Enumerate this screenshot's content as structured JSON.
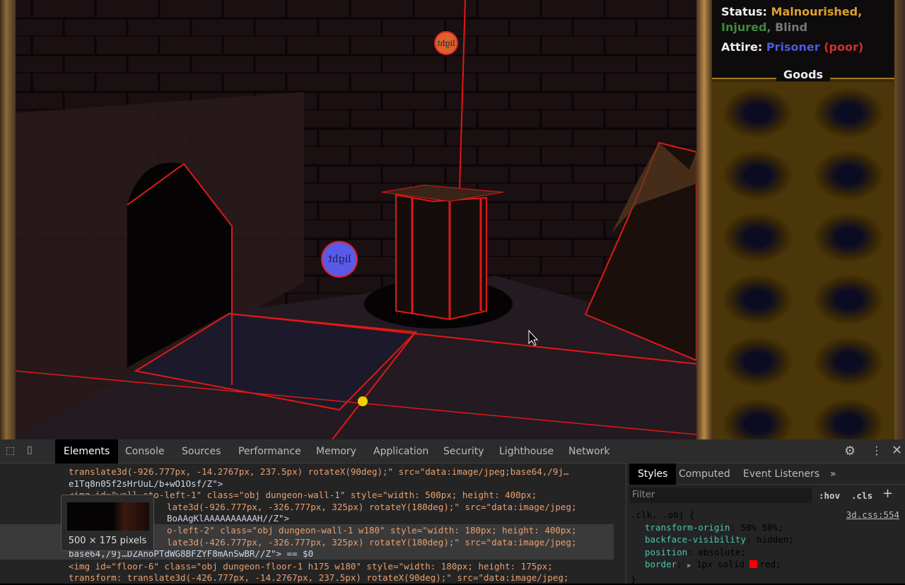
{
  "game": {
    "orbs": [
      {
        "label": "light",
        "color": "#d8642a"
      },
      {
        "label": "light",
        "color": "#5a5ae8"
      }
    ],
    "status_label": "Status:",
    "status_values": [
      "Malnourished,",
      "Injured,",
      "Blind"
    ],
    "status_colors": [
      "#e0a030",
      "#3a8a3a",
      "#777777"
    ],
    "attire_label": "Attire:",
    "attire_value": "Prisoner",
    "attire_quality": "(poor)",
    "goods_title": "Goods",
    "goods_slots": 12
  },
  "devtools": {
    "tabs": [
      "Elements",
      "Console",
      "Sources",
      "Performance",
      "Memory",
      "Application",
      "Security",
      "Lighthouse",
      "Network"
    ],
    "active_tab": "Elements",
    "code_lines": [
      "translate3d(-926.777px, -14.2767px, 237.5px) rotateX(90deg);\" src=\"data:image/jpeg;base64,/9j…",
      "e1Tq8n05f2sHrUuL/b+wO1Osf/Z\">",
      "<img id=\"wall-sto-left-1\" class=\"obj dungeon-wall-1\" style=\"width: 500px; height: 400px;",
      "late3d(-926.777px, -326.777px, 325px) rotateY(180deg);\" src=\"data:image/jpeg;",
      "BoAAgKlAAAAAAAAAAH//Z\">",
      "o-left-2\" class=\"obj dungeon-wall-1 w180\" style=\"width: 180px; height: 400px;",
      "late3d(-426.777px, -326.777px, 325px) rotateY(180deg);\" src=\"data:image/jpeg;",
      "base64,/9j…DZAnoPTdWG8BFZYF8mAnSwBR//Z\"> == $0",
      "<img id=\"floor-6\" class=\"obj dungeon-floor-1 h175 w180\" style=\"width: 180px; height: 175px;",
      "transform: translate3d(-426.777px, -14.2767px, 237.5px) rotateX(90deg);\" src=\"data:image/jpeg;"
    ],
    "tooltip": "500 × 175 pixels",
    "styles_tabs": [
      "Styles",
      "Computed",
      "Event Listeners",
      "»"
    ],
    "filter_placeholder": "Filter",
    "hov": ":hov",
    "cls": ".cls",
    "plus": "+",
    "rule_selector": ".clk, .obj {",
    "rule_source": "3d.css:554",
    "rule_props": [
      [
        "transform-origin",
        "50% 50%;"
      ],
      [
        "backface-visibility",
        "hidden;"
      ],
      [
        "position",
        "absolute;"
      ],
      [
        "border",
        "1px solid ",
        "red;"
      ]
    ],
    "rule_close": "}",
    "swatch_color": "#ff0000"
  }
}
